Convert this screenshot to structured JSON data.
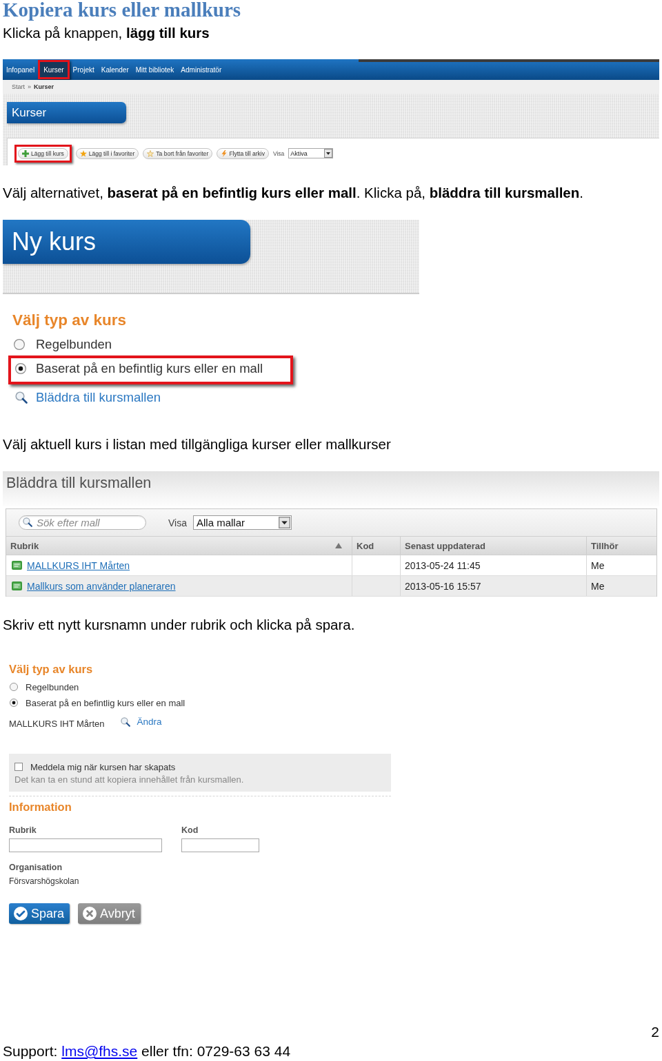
{
  "title": "Kopiera kurs eller mallkurs",
  "step_1": {
    "instruction": "Klicka på knappen, **lägg till kurs**",
    "screenshot": {
      "nav_tabs": [
        {
          "label": "Infopanel",
          "selected": false,
          "highlighted": false
        },
        {
          "label": "Kurser",
          "selected": true,
          "highlighted": true
        },
        {
          "label": "Projekt",
          "selected": false,
          "highlighted": false
        },
        {
          "label": "Kalender",
          "selected": false,
          "highlighted": false
        },
        {
          "label": "Mitt bibliotek",
          "selected": false,
          "highlighted": false
        },
        {
          "label": "Administratör",
          "selected": false,
          "highlighted": false
        }
      ],
      "breadcrumb": [
        {
          "label": "Start",
          "current": false
        },
        {
          "label": "Kurser",
          "current": true
        }
      ],
      "breadcrumb_separator": "»",
      "page_title": "Kurser",
      "toolbar_buttons": [
        {
          "label": "Lägg till kurs",
          "kind": "add",
          "highlighted": true
        },
        {
          "label": "Lägg till i favoriter",
          "kind": "favorite",
          "highlighted": false
        },
        {
          "label": "Ta bort från favoriter",
          "kind": "unfavorite",
          "highlighted": false
        },
        {
          "label": "Flytta till arkiv",
          "kind": "archive",
          "highlighted": false
        }
      ],
      "filter": {
        "label": "Visa",
        "value": "Aktiva"
      }
    }
  },
  "step_2": {
    "instruction": "Välj alternativet, **baserat på en befintlig kurs eller mall**. Klicka på, **bläddra till kursmallen**.",
    "screenshot": {
      "page_title": "Ny kurs",
      "section_title": "Välj typ av kurs",
      "options": [
        {
          "label": "Regelbunden",
          "selected": false,
          "highlighted": false
        },
        {
          "label": "Baserat på en befintlig kurs eller en mall",
          "selected": true,
          "highlighted": true
        }
      ],
      "browse_link": "Bläddra till kursmallen"
    }
  },
  "step_3": {
    "instruction": "Välj aktuell kurs i listan med tillgängliga kurser eller mallkurser",
    "screenshot": {
      "title": "Bläddra till kursmallen",
      "search": {
        "placeholder": "Sök efter mall"
      },
      "filter": {
        "label": "Visa",
        "value": "Alla mallar"
      },
      "table": {
        "columns": [
          {
            "label": "Rubrik",
            "sorted": true
          },
          {
            "label": "Kod",
            "sorted": false
          },
          {
            "label": "Senast uppdaterad",
            "sorted": false
          },
          {
            "label": "Tillhör",
            "sorted": false
          }
        ],
        "rows": [
          {
            "title": "MALLKURS IHT Mårten",
            "updated": "2013-05-24 11:45",
            "owner": "Me"
          },
          {
            "title": "Mallkurs som använder planeraren",
            "updated": "2013-05-16 15:57",
            "owner": "Me"
          }
        ]
      }
    }
  },
  "step_4": {
    "instruction": "Skriv ett nytt kursnamn under rubrik och klicka på spara.",
    "screenshot": {
      "section_title": "Välj typ av kurs",
      "options": [
        {
          "label": "Regelbunden",
          "selected": false
        },
        {
          "label": "Baserat på en befintlig kurs eller en mall",
          "selected": true
        }
      ],
      "chosen_template": "MALLKURS IHT Mårten",
      "change_link": "Ändra",
      "notify": {
        "label": "Meddela mig när kursen har skapats",
        "checked": false,
        "hint": "Det kan ta en stund att kopiera innehållet från kursmallen."
      },
      "info_title": "Information",
      "fields": [
        {
          "label": "Rubrik"
        },
        {
          "label": "Kod"
        }
      ],
      "organisation": {
        "label": "Organisation",
        "value": "Försvarshögskolan"
      },
      "buttons": [
        {
          "label": "Spara",
          "kind": "primary"
        },
        {
          "label": "Avbryt",
          "kind": "secondary"
        }
      ]
    }
  },
  "page_number": "2",
  "footer": {
    "text_before": "Support:",
    "email": "lms@fhs.se",
    "text_after": "eller tfn: 0729-63 63 44"
  }
}
